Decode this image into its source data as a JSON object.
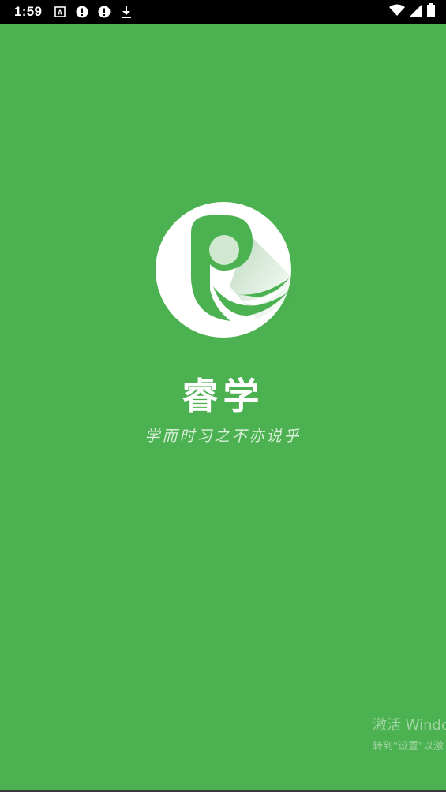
{
  "status_bar": {
    "time": "1:59",
    "icons": [
      "font-a-icon",
      "alert-icon",
      "alert-icon",
      "download-icon",
      "wifi-icon",
      "signal-icon",
      "battery-icon"
    ]
  },
  "splash": {
    "app_name": "睿学",
    "slogan": "学而时习之不亦说乎",
    "logo_icon": "r-logo-icon"
  },
  "watermark": {
    "title": "激活 Windo",
    "subtitle": "转到\"设置\"以激"
  },
  "colors": {
    "background": "#4CB151",
    "status_bar": "#000000",
    "logo_fill": "#FFFFFF"
  }
}
